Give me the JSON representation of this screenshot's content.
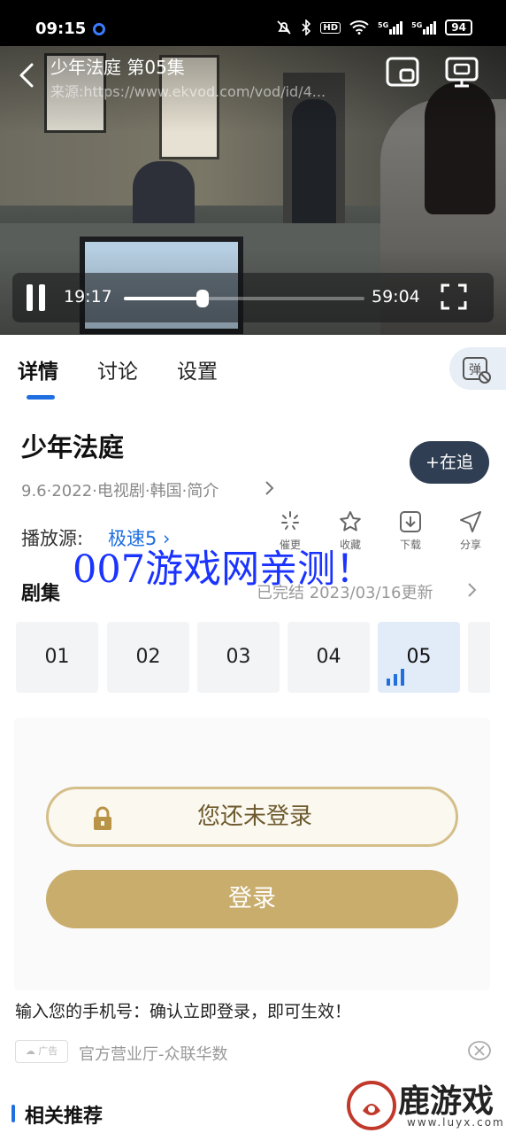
{
  "status_bar": {
    "time": "09:15",
    "network_5g_1": "5G",
    "network_5g_2": "5G",
    "battery": "94"
  },
  "player": {
    "title": "少年法庭 第05集",
    "source_url": "来源:https://www.ekvod.com/vod/id/4...",
    "current_time": "19:17",
    "duration": "59:04",
    "progress": 0.326
  },
  "tabs": [
    {
      "label": "详情",
      "active": true
    },
    {
      "label": "讨论",
      "active": false
    },
    {
      "label": "设置",
      "active": false
    }
  ],
  "danmaku_button": {
    "icon": "danmaku-off-icon",
    "char": "弹"
  },
  "show": {
    "title": "少年法庭",
    "meta": "9.6·2022·电视剧·韩国·简介",
    "follow_label": "+在追"
  },
  "source": {
    "label": "播放源:",
    "value": "极速5"
  },
  "actions": [
    {
      "label": "催更",
      "icon": "urge-icon"
    },
    {
      "label": "收藏",
      "icon": "star-icon"
    },
    {
      "label": "下载",
      "icon": "download-icon"
    },
    {
      "label": "分享",
      "icon": "share-icon"
    }
  ],
  "watermark": "007游戏网亲测！",
  "episodes_section": {
    "title": "剧集",
    "status": "已完结 2023/03/16更新",
    "items": [
      "01",
      "02",
      "03",
      "04",
      "05"
    ],
    "active_index": 4
  },
  "login": {
    "hint": "您还未登录",
    "button": "登录"
  },
  "ad": {
    "text": "输入您的手机号：确认立即登录，即可生效！",
    "badge": "广告",
    "name": "官方营业厅-众联华数"
  },
  "related": {
    "title": "相关推荐"
  },
  "brand": {
    "name": "鹿游戏",
    "url": "www.luyx.com"
  },
  "colors": {
    "accent": "#1f6fe0",
    "gold": "#c9ad6d",
    "follow_bg": "#2f3e52",
    "watermark": "#1a33ff"
  }
}
